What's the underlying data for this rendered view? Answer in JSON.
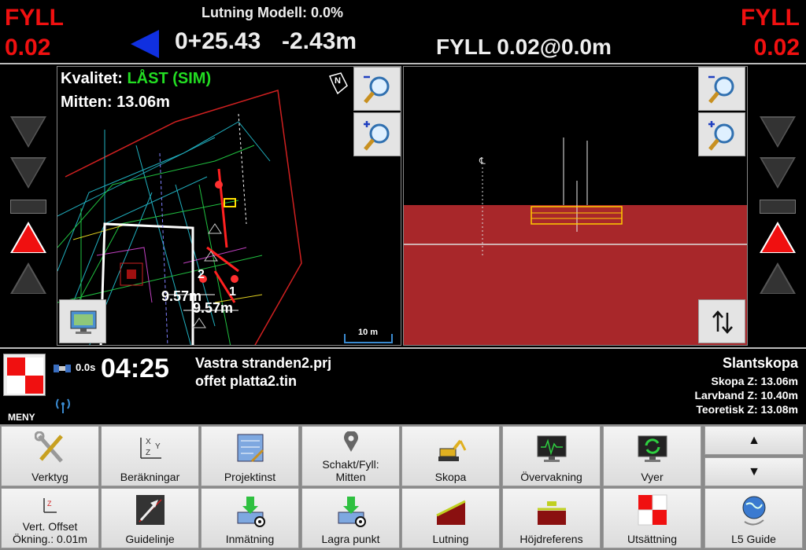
{
  "header": {
    "left_label": "FYLL",
    "left_value": "0.02",
    "right_label": "FYLL",
    "right_value": "0.02",
    "slope_model": "Lutning Modell: 0.0%",
    "station": "0+25.43",
    "offset": "-2.43m",
    "fill_info": "FYLL 0.02@0.0m"
  },
  "planview": {
    "quality_label": "Kvalitet:",
    "quality_value": "LÅST (SIM)",
    "center": "Mitten: 13.06m",
    "dim1": "9.57m",
    "dim2": "9.57m",
    "marker1": "2",
    "marker2": "1",
    "scale": "10 m",
    "north": "N"
  },
  "status": {
    "menu_label": "MENY",
    "gps_age": "0.0s",
    "time": "04:25",
    "project": "Vastra stranden2.prj",
    "surface": "offet platta2.tin",
    "tool": "Slantskopa",
    "bucket_z": "Skopa Z: 13.06m",
    "track_z": "Larvband Z: 10.40m",
    "theoretical_z": "Teoretisk Z: 13.08m"
  },
  "toolbar": {
    "row1": [
      "Verktyg",
      "Beräkningar",
      "Projektinst",
      "Schakt/Fyll:\nMitten",
      "Skopa",
      "Övervakning",
      "Vyer"
    ],
    "row2": [
      "Vert. Offset\nÖkning.: 0.01m",
      "Guidelinje",
      "Inmätning",
      "Lagra punkt",
      "Lutning",
      "Höjdreferens",
      "Utsättning",
      "L5 Guide"
    ],
    "up_arrow": "▲",
    "down_arrow": "▼"
  },
  "colors": {
    "fill_red": "#f01010",
    "locked_green": "#22dd22",
    "ground_red": "#a8272a"
  }
}
